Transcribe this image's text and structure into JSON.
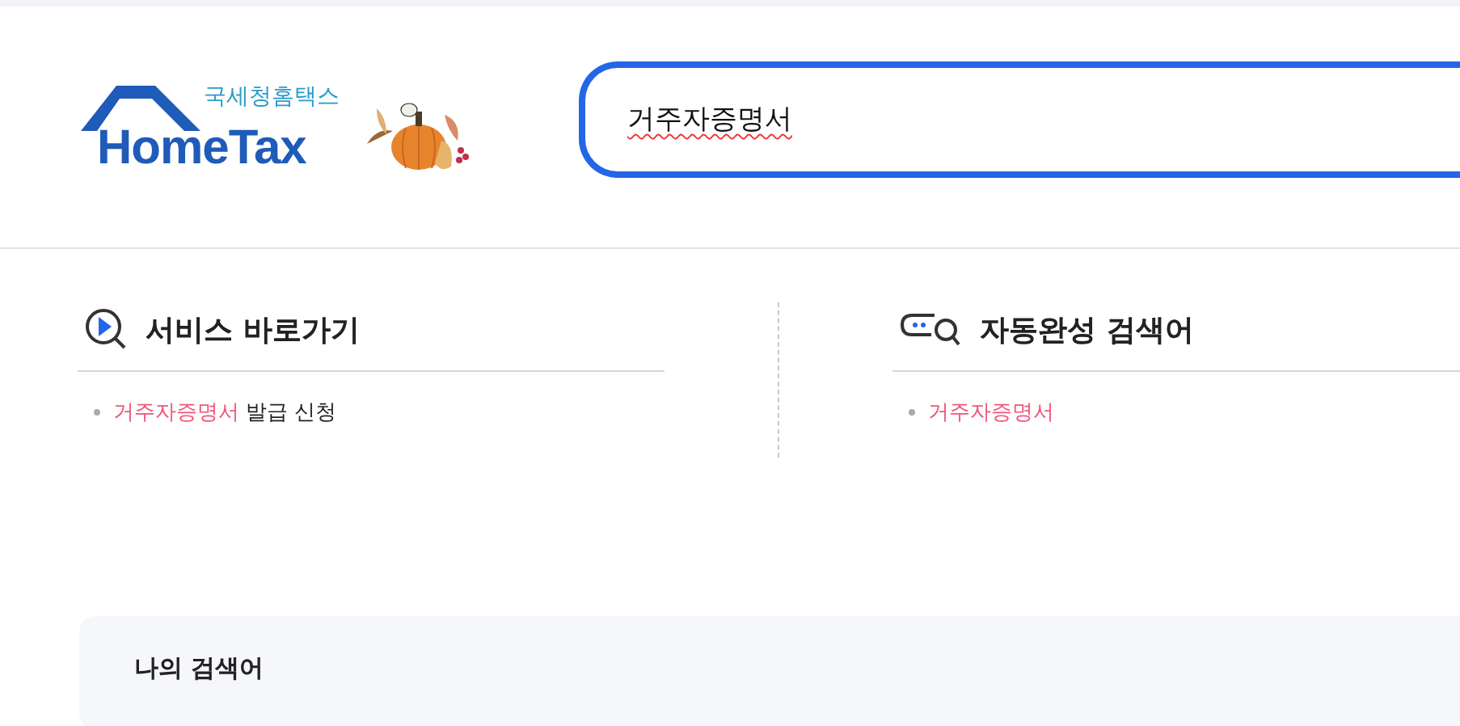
{
  "logo": {
    "caption": "국세청홈택스",
    "wordmark": "HomeTax"
  },
  "search": {
    "value": "거주자증명서"
  },
  "sections": [
    {
      "kind": "service",
      "title": "서비스 바로가기",
      "items": [
        {
          "match": "거주자증명서",
          "rest": "발급 신청"
        }
      ]
    },
    {
      "kind": "autocomplete",
      "title": "자동완성 검색어",
      "items": [
        {
          "match": "거주자증명서"
        }
      ]
    }
  ],
  "my_searches": {
    "title": "나의 검색어"
  }
}
